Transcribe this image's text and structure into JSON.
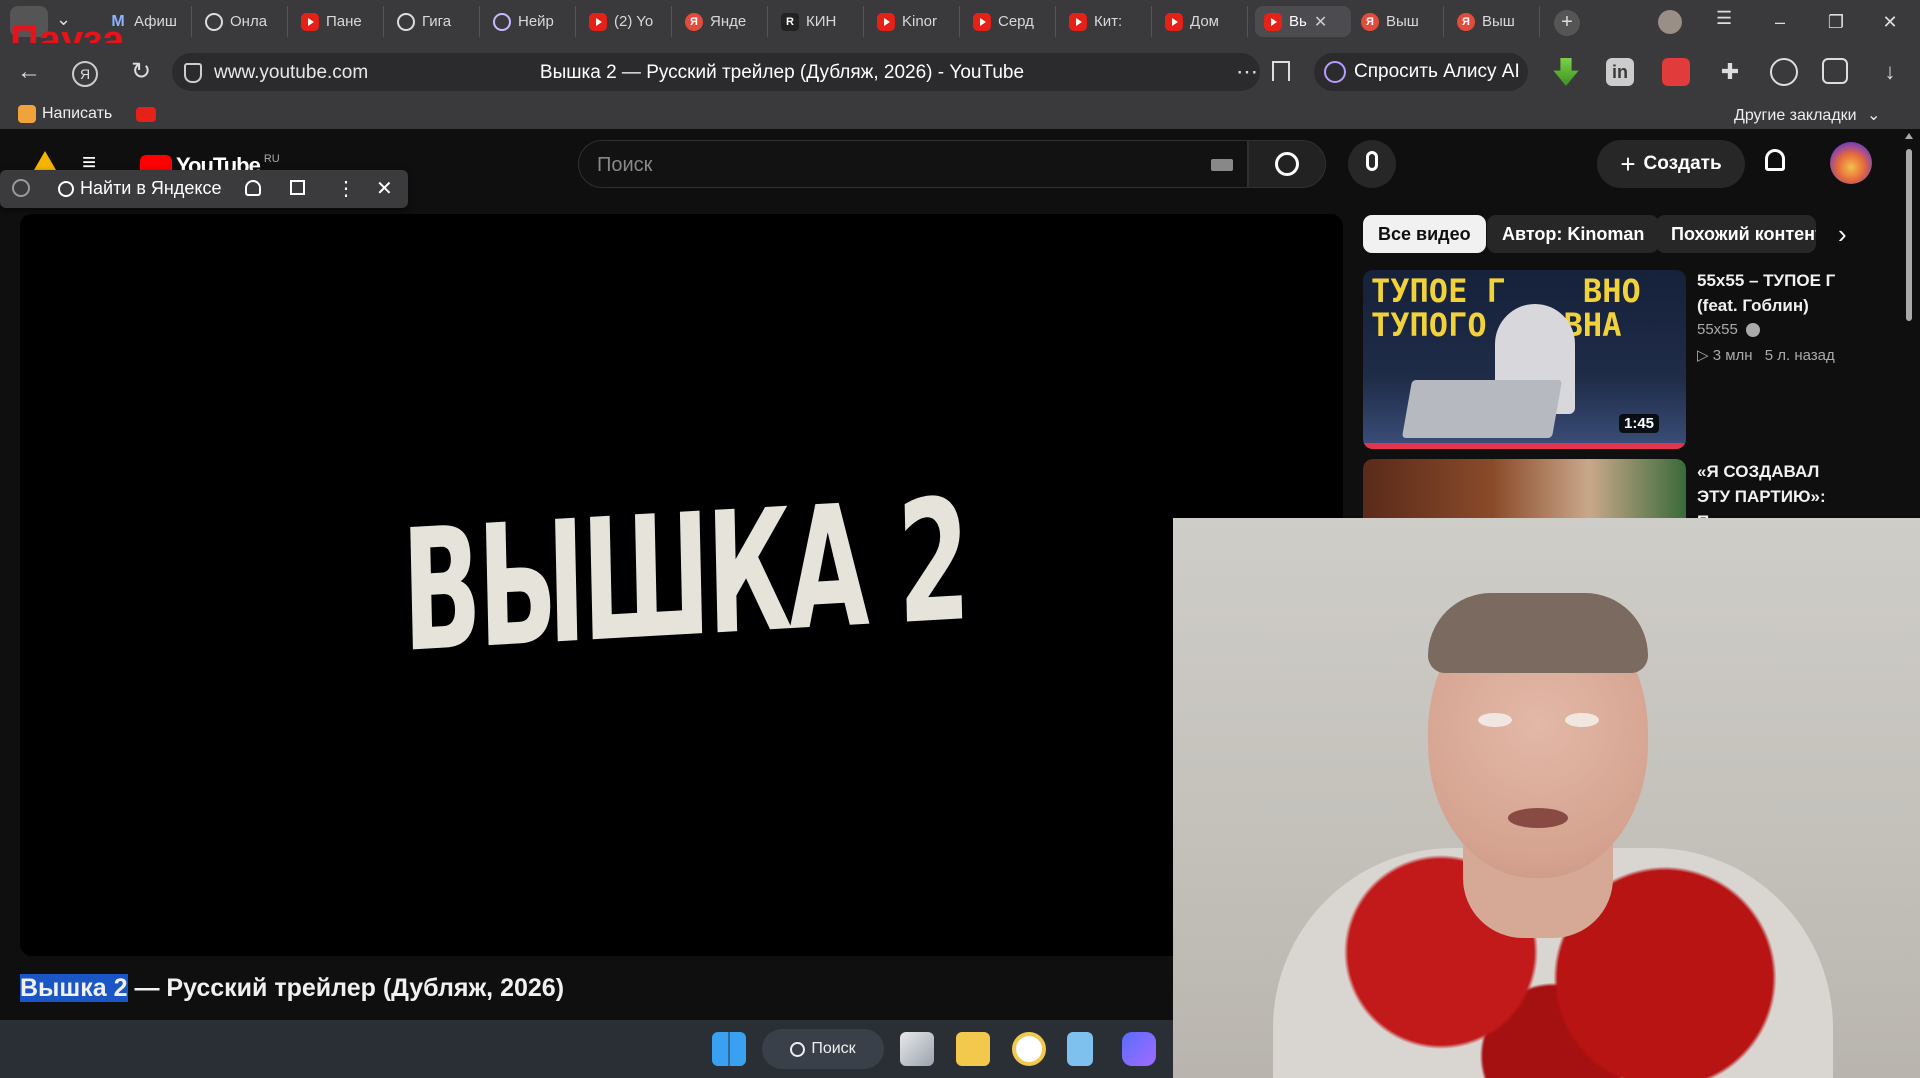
{
  "overlay": {
    "pause_label": "Пауза"
  },
  "browser": {
    "tabs": [
      {
        "label": "Афиш",
        "icon": "m-icon"
      },
      {
        "label": "Онла",
        "icon": "ring-icon"
      },
      {
        "label": "Пане",
        "icon": "youtube-icon"
      },
      {
        "label": "Гига",
        "icon": "gigachat-icon"
      },
      {
        "label": "Нейр",
        "icon": "neuro-icon"
      },
      {
        "label": "(2) Yo",
        "icon": "youtube-icon"
      },
      {
        "label": "Янде",
        "icon": "yandex-icon"
      },
      {
        "label": "КИН",
        "icon": "kinopoisk-icon"
      },
      {
        "label": "Kinor",
        "icon": "youtube-icon"
      },
      {
        "label": "Серд",
        "icon": "youtube-icon"
      },
      {
        "label": "Кит: ",
        "icon": "youtube-icon"
      },
      {
        "label": "Дом",
        "icon": "youtube-icon"
      },
      {
        "label": "Вь",
        "icon": "youtube-icon",
        "active": true
      },
      {
        "label": "Выш",
        "icon": "yandex-icon"
      },
      {
        "label": "Выш",
        "icon": "yandex-icon"
      }
    ],
    "url": "www.youtube.com",
    "page_title": "Вышка 2 — Русский трейлер (Дубляж, 2026) - YouTube",
    "alice_button": "Спросить Алису AI",
    "bookmarks": {
      "write": "Написать",
      "other": "Другие закладки"
    }
  },
  "find_bar": {
    "label": "Найти в Яндексе"
  },
  "youtube": {
    "logo_text": "YouTube",
    "region": "RU",
    "search_placeholder": "Поиск",
    "create_label": "Создать",
    "video_frame_text": "ВЫШКА 2",
    "video_title_highlight": "Вышка 2",
    "video_title_rest": " — Русский трейлер (Дубляж, 2026)",
    "chips": [
      "Все видео",
      "Автор: Kinoman",
      "Похожий контент"
    ],
    "recommendations": [
      {
        "title": "55x55 – ТУПОЕ Г (feat. Гоблин)",
        "channel": "55x55",
        "views": "3 млн",
        "age": "5 л. назад",
        "duration": "1:45",
        "thumb_text": [
          "ТУПОЕ Г    ВНО",
          "ТУПОГО    ВНА"
        ]
      },
      {
        "title": "«Я СОЗДАВАЛ ЭТУ ПАРТИЮ»: Путин"
      }
    ]
  },
  "taskbar": {
    "search_label": "Поиск"
  }
}
